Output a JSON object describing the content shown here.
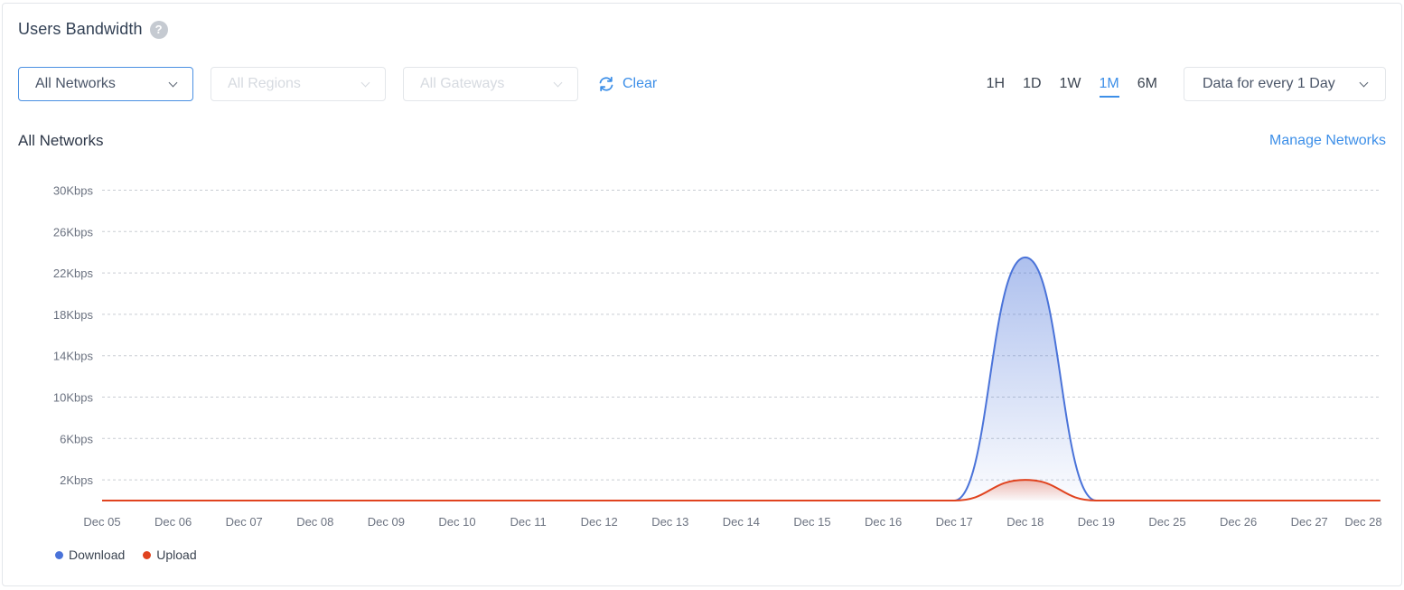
{
  "header": {
    "title": "Users Bandwidth",
    "help_glyph": "?"
  },
  "filters": {
    "network": "All Networks",
    "region": "All Regions",
    "gateway": "All Gateways",
    "clear_label": "Clear"
  },
  "time_ranges": [
    {
      "label": "1H",
      "active": false
    },
    {
      "label": "1D",
      "active": false
    },
    {
      "label": "1W",
      "active": false
    },
    {
      "label": "1M",
      "active": true
    },
    {
      "label": "6M",
      "active": false
    }
  ],
  "interval": "Data for every 1 Day",
  "section": {
    "title": "All Networks",
    "manage_link": "Manage Networks"
  },
  "colors": {
    "accent": "#3d8fe8",
    "download": "#4a73d9",
    "upload": "#e0431f"
  },
  "chart_data": {
    "type": "area",
    "categories": [
      "Dec 05",
      "Dec 06",
      "Dec 07",
      "Dec 08",
      "Dec 09",
      "Dec 10",
      "Dec 11",
      "Dec 12",
      "Dec 13",
      "Dec 14",
      "Dec 15",
      "Dec 16",
      "Dec 17",
      "Dec 18",
      "Dec 19",
      "Dec 25",
      "Dec 26",
      "Dec 27",
      "Dec 28"
    ],
    "y_ticks": [
      "30Kbps",
      "26Kbps",
      "22Kbps",
      "18Kbps",
      "14Kbps",
      "10Kbps",
      "6Kbps",
      "2Kbps"
    ],
    "y_tick_values": [
      30,
      26,
      22,
      18,
      14,
      10,
      6,
      2
    ],
    "ylim": [
      0,
      30
    ],
    "grid": true,
    "legend_placement": "bottom-left",
    "series": [
      {
        "name": "Download",
        "values": [
          0,
          0,
          0,
          0,
          0,
          0,
          0,
          0,
          0,
          0,
          0,
          0,
          0,
          23.5,
          0,
          0,
          0,
          0,
          0
        ]
      },
      {
        "name": "Upload",
        "values": [
          0,
          0,
          0,
          0,
          0,
          0,
          0,
          0,
          0,
          0,
          0,
          0,
          0,
          2,
          0,
          0,
          0,
          0,
          0
        ]
      }
    ]
  }
}
